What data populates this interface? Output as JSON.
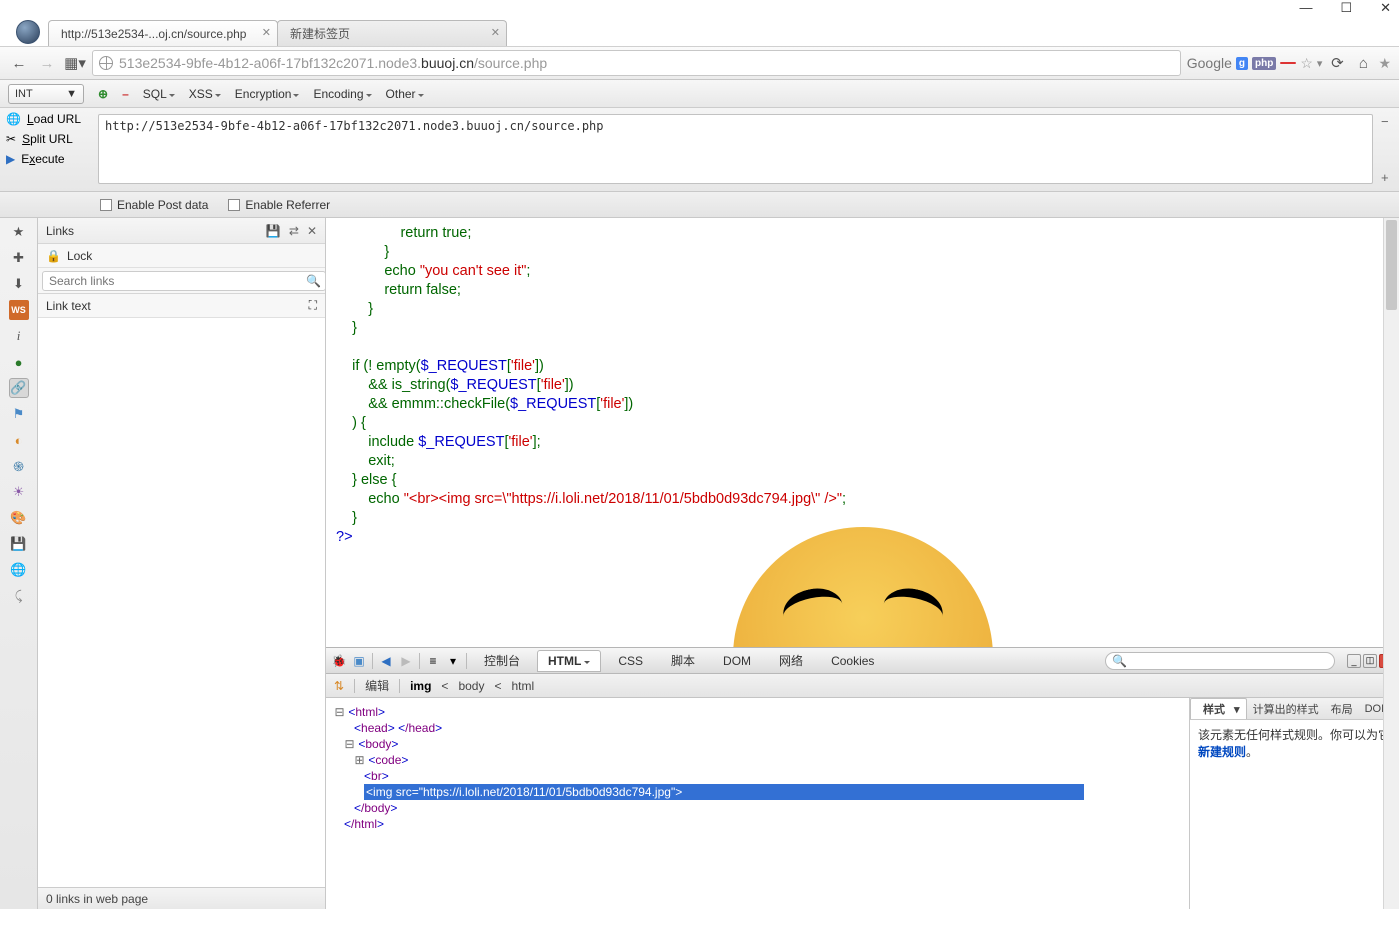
{
  "window": {
    "min": "—",
    "max": "☐",
    "close": "✕"
  },
  "tabs": [
    {
      "title": "http://513e2534-...oj.cn/source.php",
      "active": true
    },
    {
      "title": "新建标签页",
      "active": false
    }
  ],
  "urlbar": {
    "prefix": "513e2534-9bfe-4b12-a06f-17bf132c2071.node3.",
    "host": "buuoj.cn",
    "suffix": "/source.php",
    "google": "Google"
  },
  "hackbar": {
    "int": "INT",
    "menus": [
      "SQL",
      "XSS",
      "Encryption",
      "Encoding",
      "Other"
    ],
    "actions": {
      "load": "Load URL",
      "split": "Split URL",
      "exec": "Execute"
    },
    "url": "http://513e2534-9bfe-4b12-a06f-17bf132c2071.node3.buuoj.cn/source.php",
    "enable_post": "Enable Post data",
    "enable_ref": "Enable Referrer"
  },
  "links_panel": {
    "title": "Links",
    "lock": "Lock",
    "search_ph": "Search links",
    "linktext": "Link text",
    "footer": "0 links in web page"
  },
  "code": {
    "l1": "                return true;",
    "l2": "            }",
    "l3a": "            echo ",
    "l3b": "\"you can't see it\"",
    "l3c": ";",
    "l4": "            return false;",
    "l5": "        }",
    "l6": "    }",
    "l7a": "    if (! empty(",
    "l7b": "$_REQUEST",
    "l7c": "[",
    "l7d": "'file'",
    "l7e": "])",
    "l8a": "        && is_string(",
    "l8b": "$_REQUEST",
    "l8c": "[",
    "l8d": "'file'",
    "l8e": "])",
    "l9a": "        && emmm::checkFile(",
    "l9b": "$_REQUEST",
    "l9c": "[",
    "l9d": "'file'",
    "l9e": "])",
    "l10": "    ) {",
    "l11a": "        include ",
    "l11b": "$_REQUEST",
    "l11c": "[",
    "l11d": "'file'",
    "l11e": "];",
    "l12": "        exit;",
    "l13": "    } else {",
    "l14a": "        echo ",
    "l14b": "\"<br><img src=\\\"https://i.loli.net/2018/11/01/5bdb0d93dc794.jpg\\\" />\"",
    "l14c": ";",
    "l15": "    }",
    "l16": "?>"
  },
  "devtools": {
    "tabs": {
      "console": "控制台",
      "html": "HTML",
      "css": "CSS",
      "script": "脚本",
      "dom": "DOM",
      "net": "网络",
      "cookies": "Cookies"
    },
    "edit": "编辑",
    "crumb": {
      "img": "img",
      "body": "body",
      "html": "html"
    },
    "tree": {
      "html_open": "html",
      "head": "head",
      "head_close": "/head",
      "body": "body",
      "code": "code",
      "br": "br",
      "img": "img src=\"https://i.loli.net/2018/11/01/5bdb0d93dc794.jpg\"",
      "body_close": "/body",
      "html_close": "/html"
    },
    "side_tabs": {
      "style": "样式",
      "computed": "计算出的样式",
      "layout": "布局",
      "dom": "DOM"
    },
    "side_msg_a": "该元素无任何样式规则。你可以为它",
    "side_msg_b": "新建规则",
    "side_msg_c": "。"
  }
}
